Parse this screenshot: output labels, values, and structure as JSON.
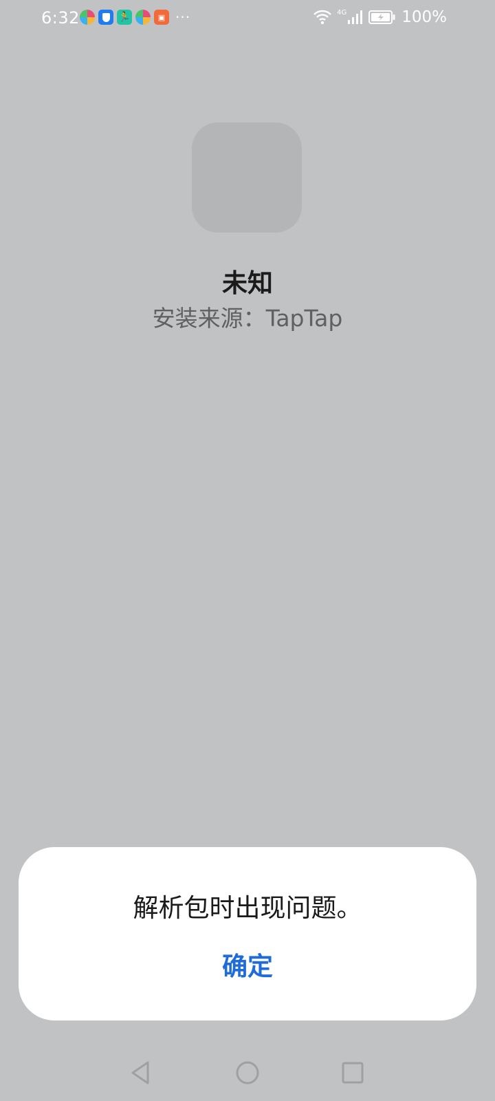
{
  "status_bar": {
    "time": "6:32",
    "notifications": [
      {
        "icon": "pinwheel-icon"
      },
      {
        "icon": "shield-icon"
      },
      {
        "icon": "runner-icon",
        "glyph": "🏃"
      },
      {
        "icon": "pinwheel-icon"
      },
      {
        "icon": "shopping-bag-icon"
      }
    ],
    "more_indicator": "···",
    "network_label": "4G",
    "battery_percent": "100%"
  },
  "app": {
    "name": "未知",
    "install_source": "安装来源：TapTap"
  },
  "dialog": {
    "message": "解析包时出现问题。",
    "confirm_label": "确定"
  },
  "colors": {
    "background": "#c1c2c4",
    "dialog_background": "#ffffff",
    "accent": "#1f6bd8",
    "icon_placeholder": "#b4b5b7"
  }
}
